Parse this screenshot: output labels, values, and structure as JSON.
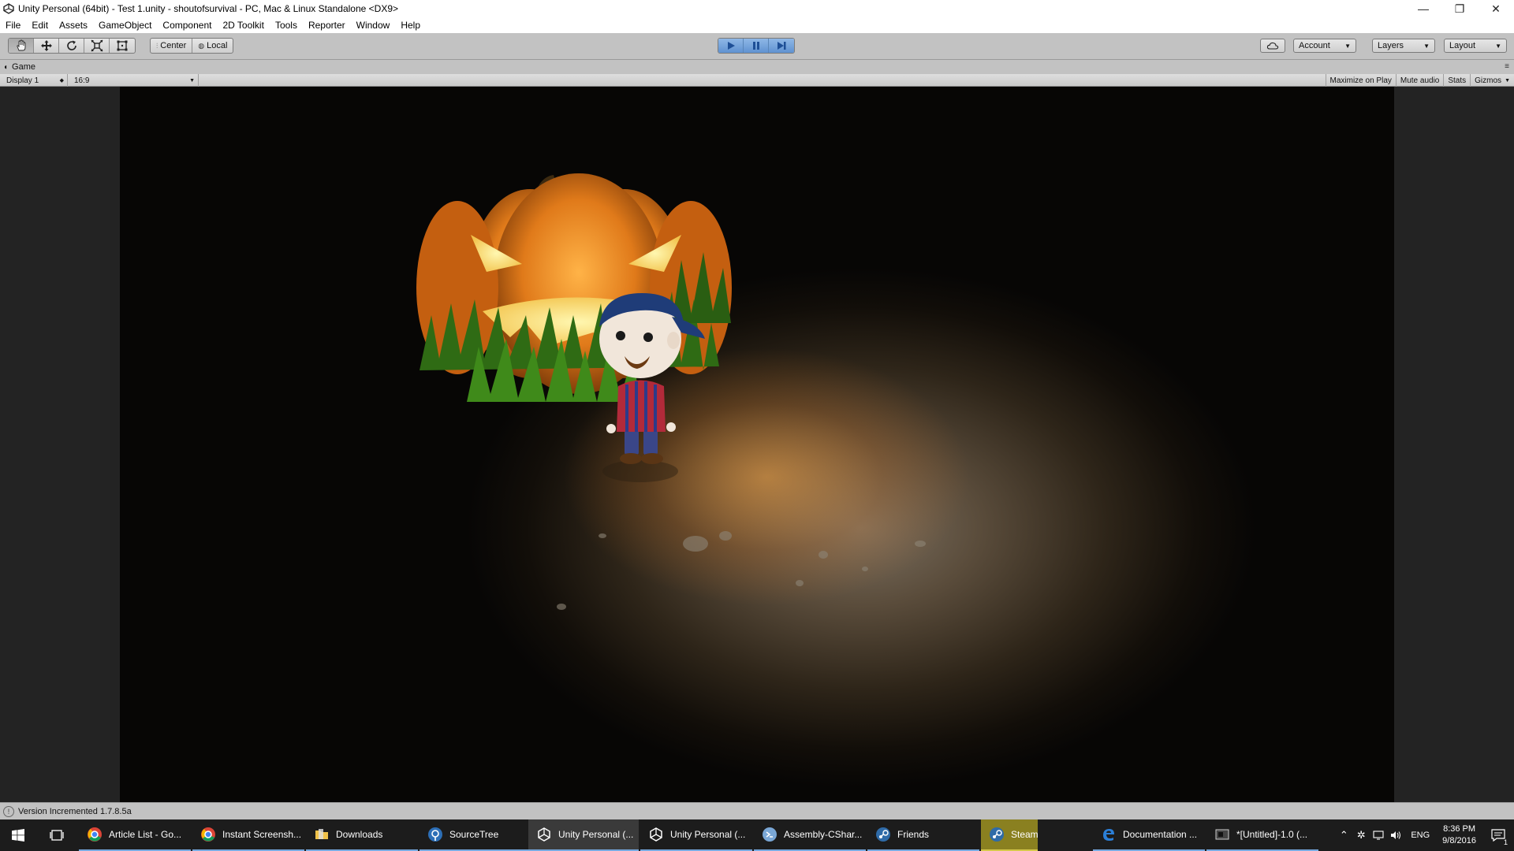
{
  "window": {
    "title": "Unity Personal (64bit) - Test 1.unity - shoutofsurvival - PC, Mac & Linux Standalone <DX9>",
    "minimize_glyph": "—",
    "maximize_glyph": "❐",
    "close_glyph": "✕"
  },
  "menu": [
    "File",
    "Edit",
    "Assets",
    "GameObject",
    "Component",
    "2D Toolkit",
    "Tools",
    "Reporter",
    "Window",
    "Help"
  ],
  "toolbar": {
    "tools": [
      "hand-tool-icon",
      "move-tool-icon",
      "rotate-tool-icon",
      "scale-tool-icon",
      "rect-tool-icon"
    ],
    "pivot_center": "Center",
    "pivot_local": "Local",
    "play_controls": [
      "play-icon",
      "pause-icon",
      "step-icon"
    ],
    "account": "Account",
    "layers": "Layers",
    "layout": "Layout"
  },
  "game_tab": {
    "label": "Game",
    "display": "Display 1",
    "aspect": "16:9",
    "maximize_on_play": "Maximize on Play",
    "mute_audio": "Mute audio",
    "stats": "Stats",
    "gizmos": "Gizmos"
  },
  "status": {
    "message": "Version Incremented 1.7.8.5a"
  },
  "taskbar": {
    "items": [
      {
        "label": "Article List - Go...",
        "icon": "chrome-icon"
      },
      {
        "label": "Instant Screensh...",
        "icon": "chrome-icon"
      },
      {
        "label": "Downloads",
        "icon": "folder-icon"
      },
      {
        "label": "SourceTree",
        "icon": "sourcetree-icon"
      },
      {
        "label": "Unity Personal (...",
        "icon": "unity-icon"
      },
      {
        "label": "Unity Personal (...",
        "icon": "unity-icon"
      },
      {
        "label": "Assembly-CShar...",
        "icon": "visual-studio-icon"
      },
      {
        "label": "Friends",
        "icon": "steam-icon"
      },
      {
        "label": "Steam",
        "icon": "steam-icon"
      },
      {
        "label": "Documentation ...",
        "icon": "edge-icon"
      },
      {
        "label": "*[Untitled]-1.0 (...",
        "icon": "image-editor-icon"
      }
    ],
    "language": "ENG",
    "time": "8:36 PM",
    "date": "9/8/2016",
    "notification_count": "1"
  },
  "colors": {
    "editor_bg": "#c2c2c2",
    "play_active": "#5f92d1",
    "taskbar_bg": "#1c1c1c",
    "steam_highlight": "#8a8020",
    "pumpkin": "#e07a1a"
  }
}
